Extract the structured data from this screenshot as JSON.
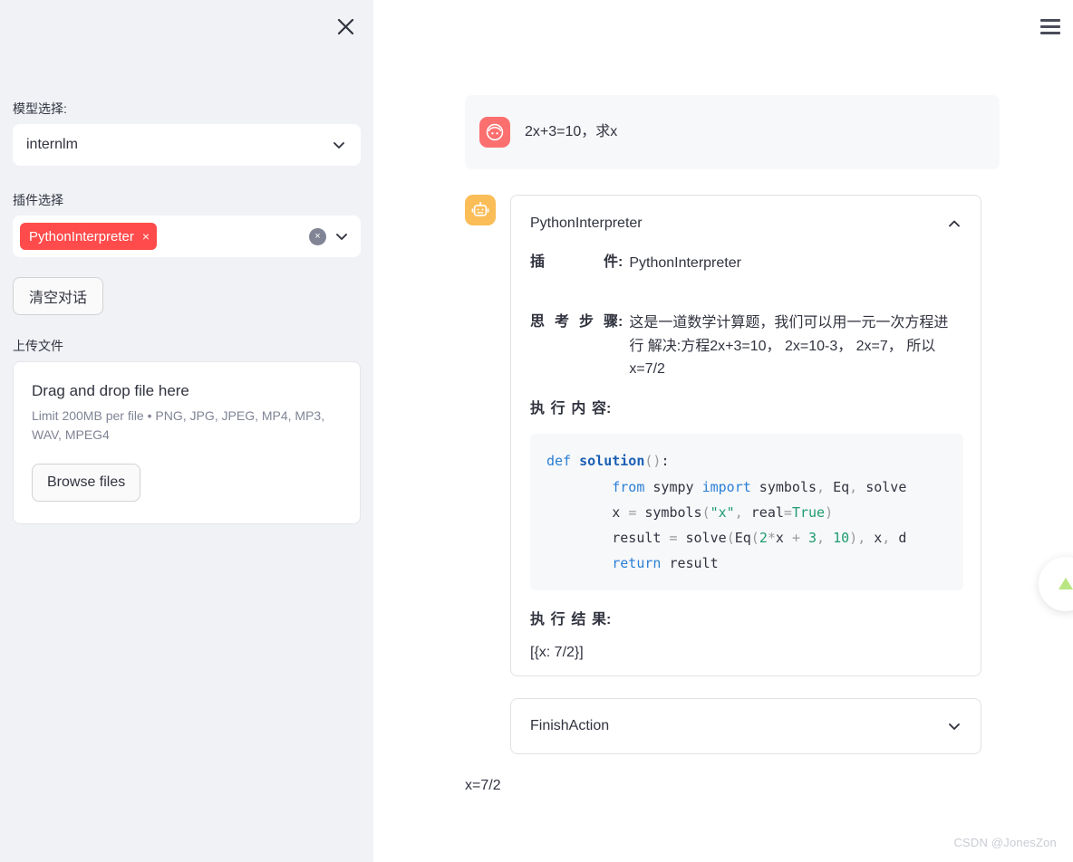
{
  "sidebar": {
    "close_icon": "close-icon",
    "model": {
      "label": "模型选择:",
      "value": "internlm"
    },
    "plugin": {
      "label": "插件选择",
      "chips": [
        "PythonInterpreter"
      ],
      "chip_remove": "×",
      "clear_all": "×"
    },
    "clear_chat_button": "清空对话",
    "upload": {
      "label": "上传文件",
      "title": "Drag and drop file here",
      "limit": "Limit 200MB per file • PNG, JPG, JPEG, MP4, MP3, WAV, MPEG4",
      "browse_button": "Browse files"
    }
  },
  "main": {
    "menu_icon": "hamburger-menu-icon",
    "user_message": {
      "avatar": "user-avatar-icon",
      "text": "2x+3=10，求x"
    },
    "assistant_message": {
      "avatar": "bot-avatar-icon",
      "action_card": {
        "title": "PythonInterpreter",
        "expanded": true,
        "plugin_key": "插件",
        "plugin_value": "PythonInterpreter",
        "thought_key": "思考步骤",
        "thought_value": "这是一道数学计算题，我们可以用一元一次方程进行 解决:方程2x+3=10， 2x=10-3， 2x=7， 所以x=7/2",
        "exec_content_label": "执行内容",
        "code": {
          "language": "python",
          "lines": [
            "def solution():",
            "        from sympy import symbols, Eq, solve",
            "        x = symbols(\"x\", real=True)",
            "        result = solve(Eq(2*x + 3, 10), x, d",
            "        return result"
          ]
        },
        "exec_result_label": "执行结果",
        "exec_result_value": "[{x: 7/2}]"
      },
      "finish_card": {
        "title": "FinishAction",
        "expanded": false
      },
      "final_answer": "x=7/2"
    },
    "fab": "scroll-to-top-icon",
    "watermark": "CSDN @JonesZon"
  }
}
